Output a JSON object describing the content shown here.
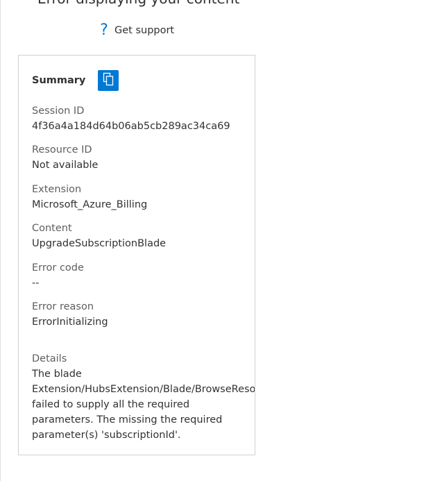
{
  "header": {
    "title": "Error displaying your content",
    "support_label": "Get support",
    "support_icon": "help-question-icon"
  },
  "summary": {
    "title": "Summary",
    "copy_icon": "copy-icon",
    "fields": [
      {
        "label": "Session ID",
        "value": "4f36a4a184d64b06ab5cb289ac34ca69"
      },
      {
        "label": "Resource ID",
        "value": "Not available"
      },
      {
        "label": "Extension",
        "value": "Microsoft_Azure_Billing"
      },
      {
        "label": "Content",
        "value": "UpgradeSubscriptionBlade"
      },
      {
        "label": "Error code",
        "value": "--"
      },
      {
        "label": "Error reason",
        "value": "ErrorInitializing"
      }
    ],
    "details": {
      "label": "Details",
      "lines": [
        "The blade",
        "Extension/HubsExtension/Blade/BrowseResou",
        "failed to supply all the required",
        "parameters. The missing the required",
        "parameter(s) 'subscriptionId'."
      ]
    }
  },
  "colors": {
    "accent": "#0078d4",
    "text": "#323130",
    "label": "#605e5c",
    "border": "#d2d0ce"
  }
}
